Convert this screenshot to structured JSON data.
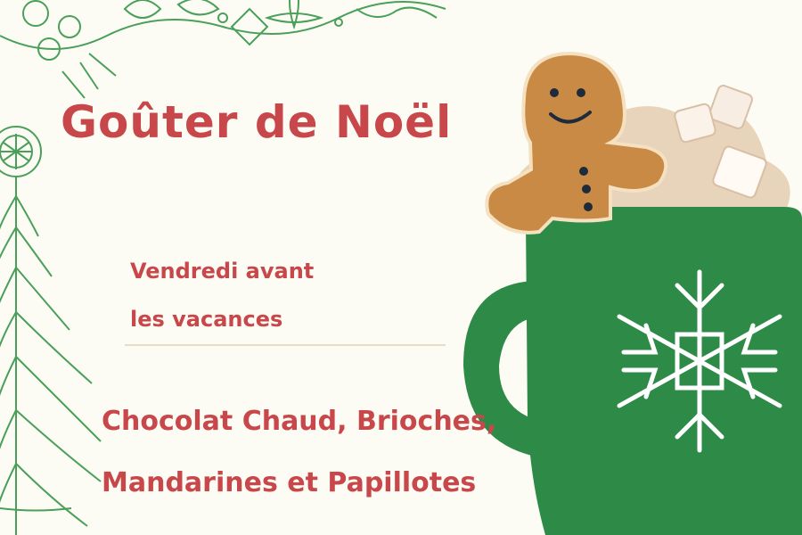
{
  "title": "Goûter de Noël",
  "date_lines": [
    "Vendredi avant",
    "les vacances"
  ],
  "menu_lines": [
    "Chocolat Chaud, Brioches,",
    "Mandarines et Papillotes"
  ],
  "colors": {
    "background": "#fdfcf4",
    "text_red": "#c8474a",
    "holly_green": "#4aa05a",
    "mug_green": "#2e8b47",
    "gingerbread": "#c98a45",
    "cream": "#eddcc6"
  },
  "icons": [
    "holly-garland-icon",
    "christmas-tree-icon",
    "gingerbread-man-icon",
    "hot-chocolate-mug-icon",
    "snowflake-icon",
    "marshmallow-icon"
  ]
}
